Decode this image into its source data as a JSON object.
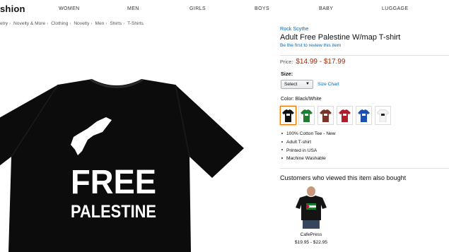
{
  "header": {
    "brand": "shion",
    "nav": [
      "WOMEN",
      "MEN",
      "GIRLS",
      "BOYS",
      "BABY",
      "LUGGAGE"
    ]
  },
  "breadcrumb": [
    "etry",
    "Novelty & More",
    "Clothing",
    "Novelty",
    "Men",
    "Shirts",
    "T-Shirts"
  ],
  "product": {
    "byline": "Rock Scythe",
    "title": "Adult Free Palestine W/map T-shirt",
    "review_link": "Be the first to review this item",
    "price_label": "Price:",
    "price_value": "$14.99 - $17.99",
    "size_label": "Size:",
    "size_selected": "Select",
    "size_chart": "Size Chart",
    "color_label": "Color:",
    "color_value": "Black/White",
    "swatches": [
      {
        "name": "Black",
        "color": "#111111",
        "selected": true
      },
      {
        "name": "Green",
        "color": "#1e7d2e",
        "selected": false
      },
      {
        "name": "Brown",
        "color": "#7a3328",
        "selected": false
      },
      {
        "name": "Red",
        "color": "#b01c2a",
        "selected": false
      },
      {
        "name": "Blue",
        "color": "#1c4fae",
        "selected": false
      },
      {
        "name": "White",
        "color": "#f4f4f4",
        "selected": false
      }
    ],
    "bullets": [
      "100% Cotton Tee - New",
      "Adult T-shirt",
      "Printed in USA",
      "Machine Washable"
    ],
    "shirt_text_line1": "FREE",
    "shirt_text_line2": "PALESTINE"
  },
  "also_bought": {
    "title": "Customers who viewed this item also bought",
    "item_brand": "CafePress",
    "item_price": "$19.95 - $22.95"
  },
  "colors": {
    "link": "#0066c0",
    "price": "#b12704",
    "selected_swatch_border": "#e77600"
  }
}
